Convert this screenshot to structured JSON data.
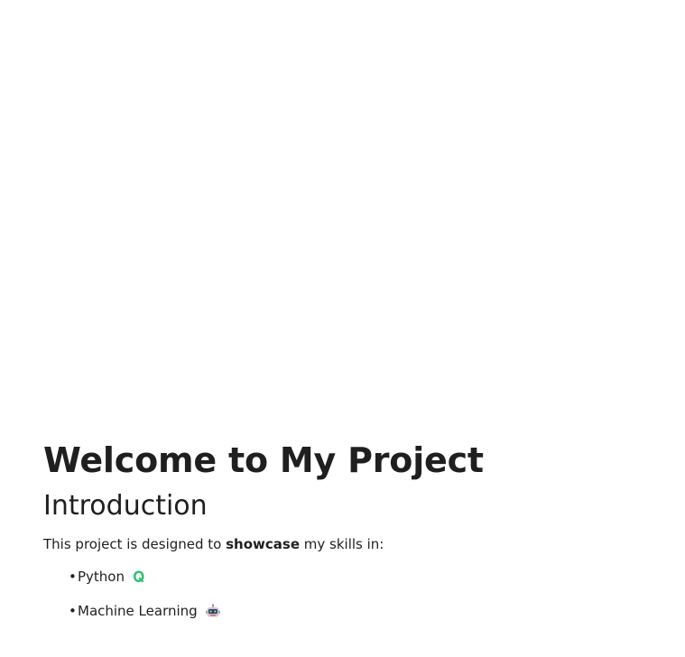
{
  "document": {
    "title": "Welcome to My Project",
    "section_heading": "Introduction",
    "intro": {
      "before": "This project is designed to ",
      "emphasis": "showcase",
      "after": " my skills in:"
    },
    "bullet_glyph": "•",
    "skills": [
      {
        "label": "Python",
        "icon": "python-icon"
      },
      {
        "label": "Machine Learning",
        "icon": "robot-icon"
      }
    ]
  }
}
